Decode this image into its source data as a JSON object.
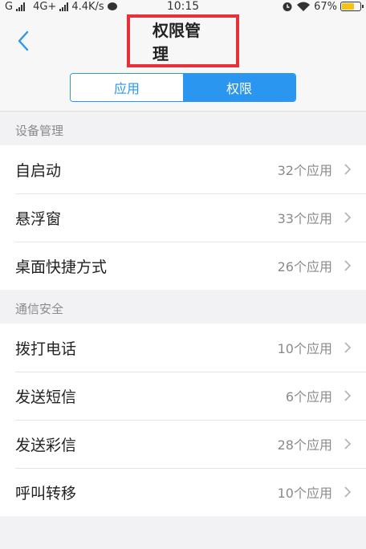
{
  "status_bar": {
    "left_carrier": "G",
    "network_type": "4G+",
    "speed": "4.4K/s",
    "time": "10:15",
    "battery_percent": "67%",
    "battery_level": 0.67
  },
  "header": {
    "title": "权限管理"
  },
  "tabs": [
    {
      "label": "应用",
      "active": false
    },
    {
      "label": "权限",
      "active": true
    }
  ],
  "sections": [
    {
      "title": "设备管理",
      "items": [
        {
          "label": "自启动",
          "count": "32个应用"
        },
        {
          "label": "悬浮窗",
          "count": "33个应用"
        },
        {
          "label": "桌面快捷方式",
          "count": "26个应用"
        }
      ]
    },
    {
      "title": "通信安全",
      "items": [
        {
          "label": "拨打电话",
          "count": "10个应用"
        },
        {
          "label": "发送短信",
          "count": "6个应用"
        },
        {
          "label": "发送彩信",
          "count": "28个应用"
        },
        {
          "label": "呼叫转移",
          "count": "10个应用"
        }
      ]
    }
  ],
  "colors": {
    "accent": "#2b96ef",
    "highlight_box": "#e8303a",
    "battery": "#f3c21a"
  }
}
